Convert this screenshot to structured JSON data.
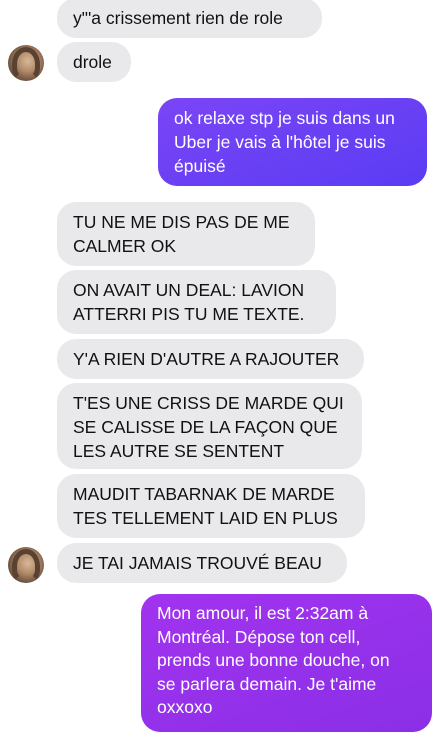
{
  "messages": [
    {
      "sender": "them",
      "text": "y\"'a crissement rien de role"
    },
    {
      "sender": "them",
      "text": "drole"
    },
    {
      "sender": "me",
      "text": "ok relaxe stp je suis dans un\nUber je vais à l'hôtel je suis\népuisé"
    },
    {
      "sender": "them",
      "text": "TU NE ME DIS PAS DE ME\nCALMER OK"
    },
    {
      "sender": "them",
      "text": "ON AVAIT UN DEAL: LAVION\nATTERRI PIS TU ME TEXTE."
    },
    {
      "sender": "them",
      "text": "Y'A RIEN D'AUTRE A RAJOUTER"
    },
    {
      "sender": "them",
      "text": "T'ES UNE CRISS DE MARDE QUI\nSE CALISSE DE LA FAÇON QUE\nLES AUTRE SE SENTENT"
    },
    {
      "sender": "them",
      "text": "MAUDIT TABARNAK DE MARDE\nTES TELLEMENT LAID EN PLUS"
    },
    {
      "sender": "them",
      "text": "JE TAI JAMAIS TROUVÉ BEAU"
    },
    {
      "sender": "me",
      "text": "Mon amour, il est 2:32am à\nMontréal. Dépose ton cell,\nprends une bonne douche, on\nse parlera demain. Je t'aime\noxxoxo"
    }
  ],
  "colors": {
    "incoming_bubble": "#e9e9eb",
    "outgoing_bubble_1": "#6a40f5",
    "outgoing_bubble_2": "#9631ea"
  },
  "icons": {
    "contact_avatar": "contact-avatar"
  }
}
